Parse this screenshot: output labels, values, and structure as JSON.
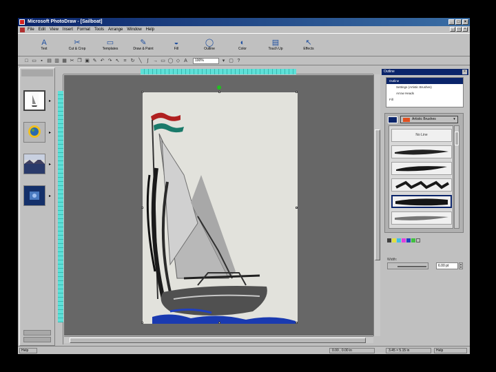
{
  "titlebar": {
    "title": "Microsoft PhotoDraw - [Sailboat]"
  },
  "window_buttons": [
    "_",
    "□",
    "×"
  ],
  "menu": [
    "File",
    "Edit",
    "View",
    "Insert",
    "Format",
    "Tools",
    "Arrange",
    "Window",
    "Help"
  ],
  "big_toolbar": [
    {
      "label": "Text",
      "icon": "A"
    },
    {
      "label": "Cut & Crop",
      "icon": "✂"
    },
    {
      "label": "Templates",
      "icon": "▭"
    },
    {
      "label": "Draw & Paint",
      "icon": "✎"
    },
    {
      "label": "Fill",
      "icon": "◒"
    },
    {
      "label": "Outline",
      "icon": "◯"
    },
    {
      "label": "Color",
      "icon": "◐"
    },
    {
      "label": "Touch Up",
      "icon": "▤"
    },
    {
      "label": "Effects",
      "icon": "↖"
    }
  ],
  "zoom": "100%",
  "visual_menu": {
    "header": ""
  },
  "outline_panel": {
    "title": "Outline",
    "tree": [
      {
        "label": "Outline",
        "selected": true,
        "indent": false
      },
      {
        "label": "Settings (Artistic Brushes)",
        "selected": false,
        "indent": true
      },
      {
        "label": "Arrow Heads",
        "selected": false,
        "indent": true
      },
      {
        "label": "Fill",
        "selected": false,
        "indent": false
      }
    ],
    "brush_category": "Artistic Brushes",
    "brushes": [
      "No Line",
      "",
      "",
      "",
      "",
      ""
    ],
    "selected_brush": 4,
    "width_label": "Width:",
    "width_value": "6.00 pt"
  },
  "status": {
    "help": "Help",
    "position": "0.00 , 0.00 in",
    "size": "3.45 × 5.15 in",
    "help2": "Help"
  },
  "colors": {
    "titlebar": "#0a246a",
    "ruler_highlight": "#5ee0d8",
    "scratch_area": "#676767",
    "page": "#e2e2dc"
  }
}
